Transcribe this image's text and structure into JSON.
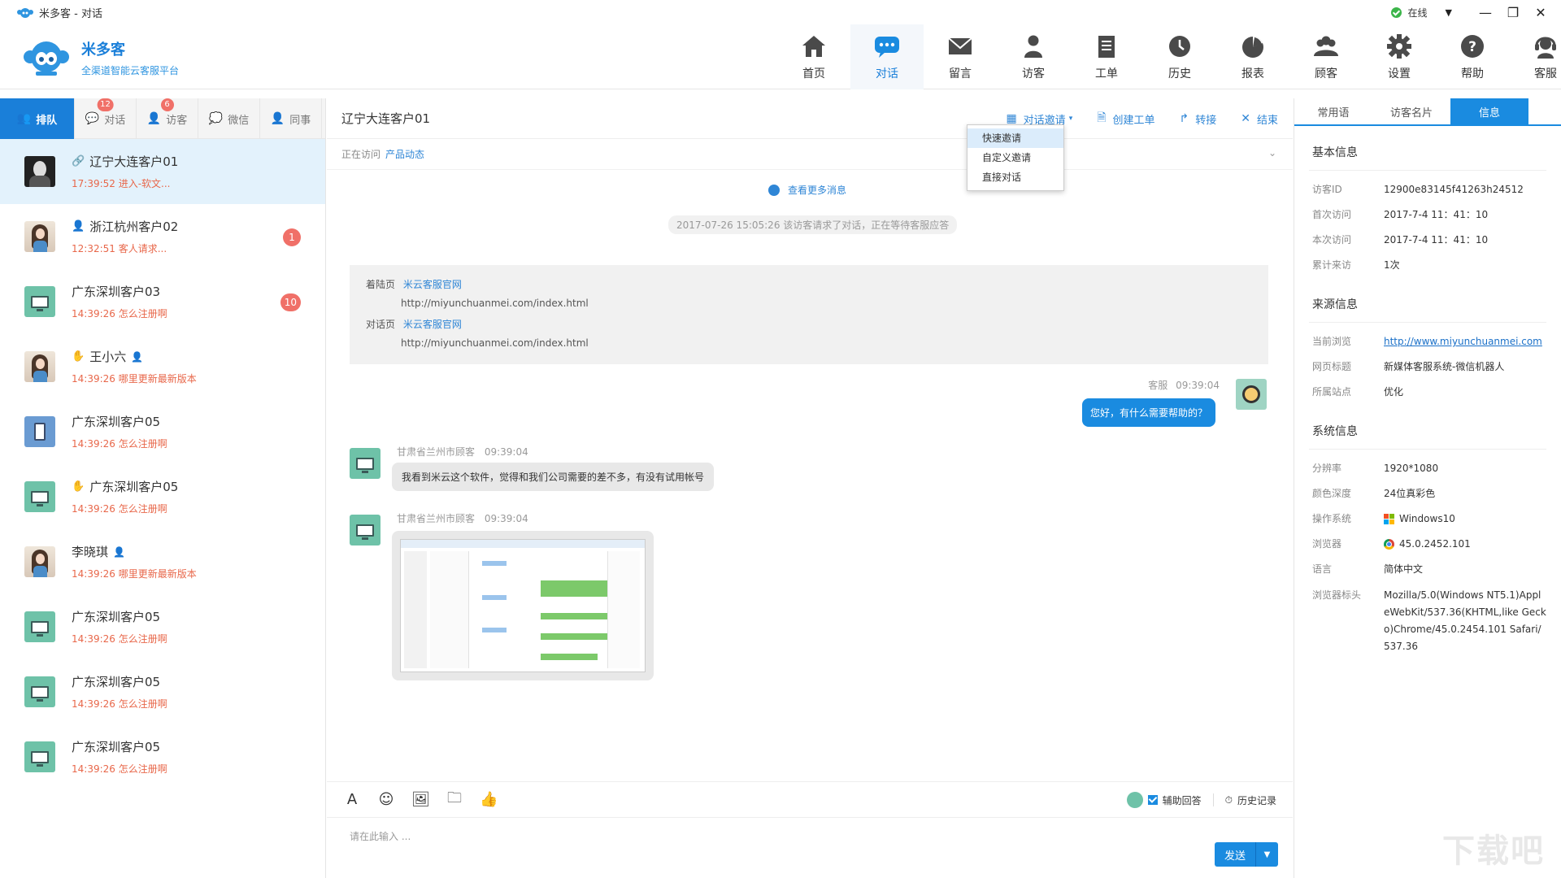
{
  "titlebar": {
    "title": "米多客 - 对话",
    "status": "在线",
    "minimize": "—",
    "restore": "❐",
    "close": "✕"
  },
  "brand": {
    "name": "米多客",
    "tagline": "全渠道智能云客服平台"
  },
  "nav": [
    {
      "label": "首页",
      "icon": "home-icon"
    },
    {
      "label": "对话",
      "icon": "chat-icon",
      "active": true
    },
    {
      "label": "留言",
      "icon": "mail-icon"
    },
    {
      "label": "访客",
      "icon": "visitor-icon"
    },
    {
      "label": "工单",
      "icon": "ticket-icon"
    },
    {
      "label": "历史",
      "icon": "clock-icon"
    },
    {
      "label": "报表",
      "icon": "pie-chart-icon"
    },
    {
      "label": "顾客",
      "icon": "customers-icon"
    },
    {
      "label": "设置",
      "icon": "gear-icon"
    },
    {
      "label": "帮助",
      "icon": "help-icon"
    },
    {
      "label": "客服",
      "icon": "headset-icon"
    }
  ],
  "left_tabs": [
    {
      "label": "排队",
      "active": true
    },
    {
      "label": "对话",
      "badge": "12"
    },
    {
      "label": "访客",
      "badge": "6"
    },
    {
      "label": "微信"
    },
    {
      "label": "同事"
    }
  ],
  "customers": [
    {
      "name": "辽宁大连客户01",
      "sub": "17:39:52 进入-软文...",
      "avatar": "dark",
      "mark": "link-icon",
      "selected": true
    },
    {
      "name": "浙江杭州客户02",
      "sub": "12:32:51 客人请求...",
      "avatar": "girl",
      "mark": "person-icon",
      "badge": "1"
    },
    {
      "name": "广东深圳客户03",
      "sub": "14:39:26 怎么注册啊",
      "avatar": "monitor",
      "badge": "10"
    },
    {
      "name": "王小六",
      "sub": "14:39:26 哪里更新最新版本",
      "avatar": "girl",
      "mark": "hand-icon",
      "mark_after": "person-icon"
    },
    {
      "name": "广东深圳客户05",
      "sub": "14:39:26 怎么注册啊",
      "avatar": "phone"
    },
    {
      "name": "广东深圳客户05",
      "sub": "14:39:26 怎么注册啊",
      "avatar": "monitor",
      "mark": "hand-icon"
    },
    {
      "name": "李晓琪",
      "sub": "14:39:26 哪里更新最新版本",
      "avatar": "girl",
      "mark_after": "person-icon"
    },
    {
      "name": "广东深圳客户05",
      "sub": "14:39:26 怎么注册啊",
      "avatar": "monitor"
    },
    {
      "name": "广东深圳客户05",
      "sub": "14:39:26 怎么注册啊",
      "avatar": "monitor"
    },
    {
      "name": "广东深圳客户05",
      "sub": "14:39:26 怎么注册啊",
      "avatar": "monitor"
    }
  ],
  "chat": {
    "title": "辽宁大连客户01",
    "actions": {
      "invite": "对话邀请",
      "create_ticket": "创建工单",
      "transfer": "转接",
      "end": "结束"
    },
    "invite_menu": [
      "快速邀请",
      "自定义邀请",
      "直接对话"
    ],
    "visiting_label": "正在访问",
    "visiting_page": "产品动态",
    "more_messages": "查看更多消息",
    "system_message": "2017-07-26 15:05:26 该访客请求了对话，正在等待客服应答",
    "landing": {
      "landing_label": "着陆页",
      "landing_title": "米云客服官网",
      "landing_url": "http://miyunchuanmei.com/index.html",
      "chat_label": "对话页",
      "chat_title": "米云客服官网",
      "chat_url": "http://miyunchuanmei.com/index.html"
    },
    "agent_name": "客服",
    "agent_time": "09:39:04",
    "agent_message": "您好，有什么需要帮助的？",
    "visitor_name": "甘肃省兰州市顾客",
    "visitor_time1": "09:39:04",
    "visitor_message": "我看到米云这个软件，觉得和我们公司需要的差不多，有没有试用帐号",
    "visitor_time2": "09:39:04",
    "assist_reply": "辅助回答",
    "history": "历史记录",
    "input_placeholder": "请在此输入 ...",
    "send": "发送"
  },
  "right_tabs": [
    {
      "label": "常用语"
    },
    {
      "label": "访客名片"
    },
    {
      "label": "信息",
      "active": true
    }
  ],
  "info": {
    "basic_title": "基本信息",
    "basic": [
      {
        "k": "访客ID",
        "v": "12900e83145f41263h24512"
      },
      {
        "k": "首次访问",
        "v": "2017-7-4  11：41：10"
      },
      {
        "k": "本次访问",
        "v": "2017-7-4  11：41：10"
      },
      {
        "k": "累计来访",
        "v": "1次"
      }
    ],
    "source_title": "来源信息",
    "source": [
      {
        "k": "当前浏览",
        "v": "http://www.miyunchuanmei.com",
        "link": true
      },
      {
        "k": "网页标题",
        "v": "新媒体客服系统-微信机器人"
      },
      {
        "k": "所属站点",
        "v": "优化"
      }
    ],
    "system_title": "系统信息",
    "system": [
      {
        "k": "分辨率",
        "v": "1920*1080"
      },
      {
        "k": "颜色深度",
        "v": "24位真彩色"
      },
      {
        "k": "操作系统",
        "v": "Windows10",
        "icon": "windows-icon"
      },
      {
        "k": "浏览器",
        "v": "45.0.2452.101",
        "icon": "chrome-icon"
      },
      {
        "k": "语言",
        "v": "简体中文"
      },
      {
        "k": "浏览器标头",
        "v": "Mozilla/5.0(Windows NT5.1)AppleWebKit/537.36(KHTML,like Gecko)Chrome/45.0.2454.101 Safari/537.36"
      }
    ]
  },
  "colors": {
    "accent": "#1a8be0",
    "badge": "#f07068",
    "subtext": "#e8674a"
  }
}
